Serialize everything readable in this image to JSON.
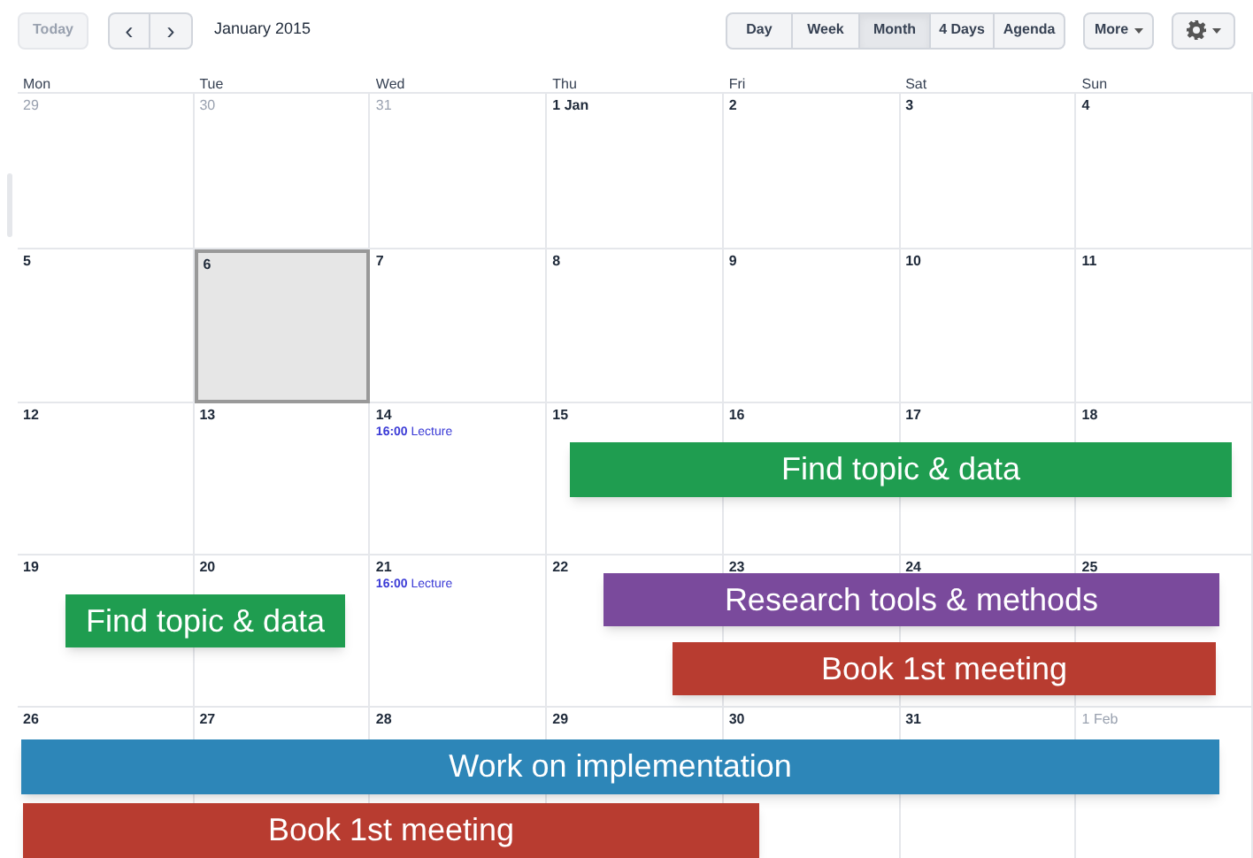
{
  "toolbar": {
    "today": {
      "label": "Today",
      "disabled": true
    },
    "prev": "‹",
    "next": "›",
    "period": "January 2015",
    "views": [
      {
        "label": "Day",
        "selected": false
      },
      {
        "label": "Week",
        "selected": false
      },
      {
        "label": "Month",
        "selected": true
      },
      {
        "label": "4 Days",
        "selected": false
      },
      {
        "label": "Agenda",
        "selected": false
      }
    ],
    "more": "More"
  },
  "weekdays": [
    "Mon",
    "Tue",
    "Wed",
    "Thu",
    "Fri",
    "Sat",
    "Sun"
  ],
  "weeks": [
    [
      {
        "label": "29",
        "muted": true,
        "selected": false
      },
      {
        "label": "30",
        "muted": true,
        "selected": false
      },
      {
        "label": "31",
        "muted": true,
        "selected": false
      },
      {
        "label": "1 Jan",
        "muted": false,
        "selected": false
      },
      {
        "label": "2",
        "muted": false,
        "selected": false
      },
      {
        "label": "3",
        "muted": false,
        "selected": false
      },
      {
        "label": "4",
        "muted": false,
        "selected": false
      }
    ],
    [
      {
        "label": "5",
        "muted": false,
        "selected": false
      },
      {
        "label": "6",
        "muted": false,
        "selected": true
      },
      {
        "label": "7",
        "muted": false,
        "selected": false
      },
      {
        "label": "8",
        "muted": false,
        "selected": false
      },
      {
        "label": "9",
        "muted": false,
        "selected": false
      },
      {
        "label": "10",
        "muted": false,
        "selected": false
      },
      {
        "label": "11",
        "muted": false,
        "selected": false
      }
    ],
    [
      {
        "label": "12",
        "muted": false,
        "selected": false
      },
      {
        "label": "13",
        "muted": false,
        "selected": false
      },
      {
        "label": "14",
        "muted": false,
        "selected": false,
        "events": [
          {
            "time": "16:00",
            "title": "Lecture"
          }
        ]
      },
      {
        "label": "15",
        "muted": false,
        "selected": false
      },
      {
        "label": "16",
        "muted": false,
        "selected": false
      },
      {
        "label": "17",
        "muted": false,
        "selected": false
      },
      {
        "label": "18",
        "muted": false,
        "selected": false
      }
    ],
    [
      {
        "label": "19",
        "muted": false,
        "selected": false
      },
      {
        "label": "20",
        "muted": false,
        "selected": false
      },
      {
        "label": "21",
        "muted": false,
        "selected": false,
        "events": [
          {
            "time": "16:00",
            "title": "Lecture"
          }
        ]
      },
      {
        "label": "22",
        "muted": false,
        "selected": false
      },
      {
        "label": "23",
        "muted": false,
        "selected": false
      },
      {
        "label": "24",
        "muted": false,
        "selected": false
      },
      {
        "label": "25",
        "muted": false,
        "selected": false
      }
    ],
    [
      {
        "label": "26",
        "muted": false,
        "selected": false
      },
      {
        "label": "27",
        "muted": false,
        "selected": false
      },
      {
        "label": "28",
        "muted": false,
        "selected": false
      },
      {
        "label": "29",
        "muted": false,
        "selected": false
      },
      {
        "label": "30",
        "muted": false,
        "selected": false
      },
      {
        "label": "31",
        "muted": false,
        "selected": false
      },
      {
        "label": "1 Feb",
        "muted": true,
        "selected": false
      }
    ]
  ],
  "overlays": [
    {
      "label": "Find topic & data",
      "color": "#1f9d50"
    },
    {
      "label": "Find topic & data",
      "color": "#1f9d50"
    },
    {
      "label": "Research tools & methods",
      "color": "#7a4a9c"
    },
    {
      "label": "Book 1st meeting",
      "color": "#b83c30"
    },
    {
      "label": "Work on implementation",
      "color": "#2d86b8"
    },
    {
      "label": "Book 1st meeting",
      "color": "#b83c30"
    }
  ]
}
